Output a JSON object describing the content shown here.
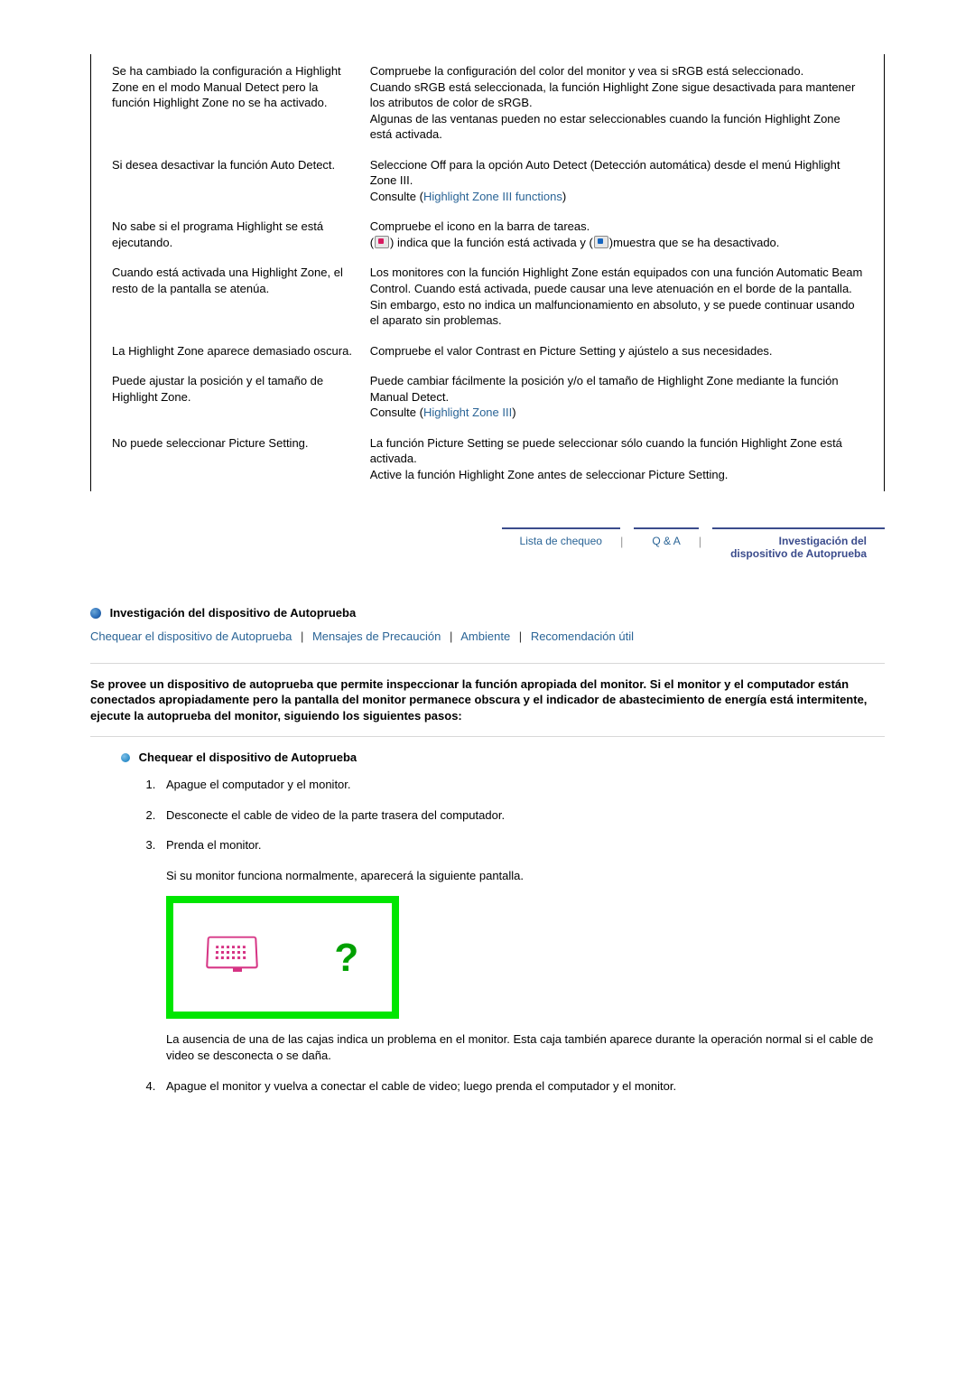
{
  "table": [
    {
      "problem": "Se ha cambiado la configuración a Highlight Zone en el modo Manual Detect pero la función Highlight Zone no se ha activado.",
      "solution": "Compruebe la configuración del color del monitor y vea si sRGB está seleccionado.\nCuando sRGB está seleccionada, la función Highlight Zone sigue desactivada para mantener los atributos de color de sRGB.\nAlgunas de las ventanas pueden no estar seleccionables cuando la función Highlight Zone está activada."
    },
    {
      "problem": "Si desea desactivar la función Auto Detect.",
      "solution_pre": "Seleccione Off para la opción Auto Detect (Detección automática) desde el menú Highlight Zone III.\nConsulte (",
      "solution_link": "Highlight Zone III functions",
      "solution_post": ")"
    },
    {
      "problem": "No sabe si el programa Highlight se está ejecutando.",
      "solution_pre": "Compruebe el icono en la barra de tareas.\n(",
      "solution_mid": ") indica que la función está activada y (",
      "solution_post": ")muestra que se ha desactivado."
    },
    {
      "problem": "Cuando está activada una Highlight Zone, el resto de la pantalla se atenúa.",
      "solution": "Los monitores con la función Highlight Zone están equipados con una función Automatic Beam Control. Cuando está activada, puede causar una leve atenuación en el borde de la pantalla. Sin embargo, esto no indica un malfuncionamiento en absoluto, y se puede continuar usando el aparato sin problemas."
    },
    {
      "problem": "La Highlight Zone aparece demasiado oscura.",
      "solution": "Compruebe el valor Contrast en Picture Setting y ajústelo a sus necesidades."
    },
    {
      "problem": "Puede ajustar la posición y el tamaño de Highlight Zone.",
      "solution_pre": "Puede cambiar fácilmente la posición y/o el tamaño de Highlight Zone mediante la función Manual Detect.\nConsulte (",
      "solution_link": "Highlight Zone III",
      "solution_post": ")"
    },
    {
      "problem": "No puede seleccionar Picture Setting.",
      "solution": "La función Picture Setting se puede seleccionar sólo cuando la función Highlight Zone está activada.\nActive la función Highlight Zone antes de seleccionar Picture Setting."
    }
  ],
  "tabs": {
    "checklist": "Lista de chequeo",
    "qa": "Q & A",
    "selftest_l1": "Investigación del",
    "selftest_l2": "dispositivo de Autoprueba"
  },
  "section_title": "Investigación del dispositivo de Autoprueba",
  "link_bar": {
    "a": "Chequear el dispositivo de Autoprueba",
    "b": "Mensajes de Precaución",
    "c": "Ambiente",
    "d": "Recomendación útil"
  },
  "intro": "Se provee un dispositivo de autoprueba que permite inspeccionar la función apropiada del monitor. Si el monitor y el computador están conectados apropiadamente pero la pantalla del monitor permanece obscura y el indicador de abastecimiento de energía está intermitente, ejecute la autoprueba del monitor, siguiendo los siguientes pasos:",
  "subhead": "Chequear el dispositivo de Autoprueba",
  "steps": {
    "s1": "Apague el computador y el monitor.",
    "s2": "Desconecte el cable de video de la parte trasera del computador.",
    "s3a": "Prenda el monitor.",
    "s3b": "Si su monitor funciona normalmente, aparecerá la siguiente pantalla.",
    "s3c": "La ausencia de una de las cajas indica un problema en el monitor. Esta caja también aparece durante la operación normal si el cable de video se desconecta o se daña.",
    "s4": "Apague el monitor y vuelva a conectar el cable de video; luego prenda el computador y el monitor."
  }
}
